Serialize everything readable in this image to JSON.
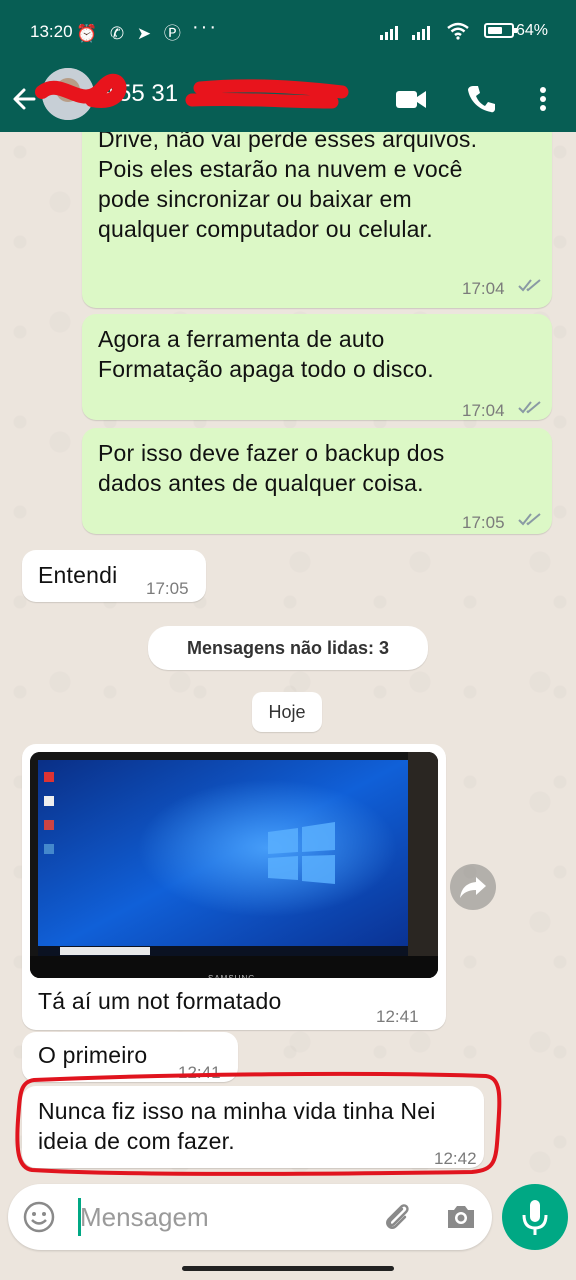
{
  "status_bar": {
    "time": "13:20",
    "left_icons": "⏰ ✆ ➤ Ⓟ",
    "dots": "···",
    "battery_percent": "64%",
    "battery_level": 0.64
  },
  "header": {
    "contact_visible_text": "+55 31"
  },
  "messages": [
    {
      "text": "Se copiar os arquivos para o Google\nDrive, não vai perde esses arquivos.\nPois eles estarão na nuvem e você\npode sincronizar ou baixar em\nqualquer computador ou celular.",
      "time": "17:04"
    },
    {
      "text": "Agora a ferramenta de auto\nFormatação apaga todo o disco.",
      "time": "17:04"
    },
    {
      "text": "Por isso deve fazer o backup dos\ndados antes de qualquer coisa.",
      "time": "17:05"
    },
    {
      "text": "Entendi",
      "time": "17:05"
    },
    {
      "text": "Tá aí um not formatado",
      "time": "12:41"
    },
    {
      "text": "O primeiro",
      "time": "12:41"
    },
    {
      "text": "Nunca fiz isso na minha vida tinha Nei\nideia de com fazer.",
      "time": "12:42"
    }
  ],
  "unread_banner": "Mensagens não lidas: 3",
  "date_divider": "Hoje",
  "photo": {
    "monitor_brand": "SAMSUNG"
  },
  "input": {
    "placeholder": "Mensagem"
  },
  "icons": {
    "back": "back-arrow-icon",
    "video": "video-call-icon",
    "call": "phone-icon",
    "menu": "more-vert-icon",
    "emoji": "emoji-icon",
    "attach": "paperclip-icon",
    "camera": "camera-icon",
    "mic": "mic-icon",
    "forward": "forward-icon"
  },
  "colors": {
    "header": "#075e54",
    "outgoing_bubble": "#dcf8c6",
    "incoming_bubble": "#ffffff",
    "accent": "#00a884",
    "highlight_ring": "#e0141e",
    "read_ticks": "#8a9aa4"
  }
}
